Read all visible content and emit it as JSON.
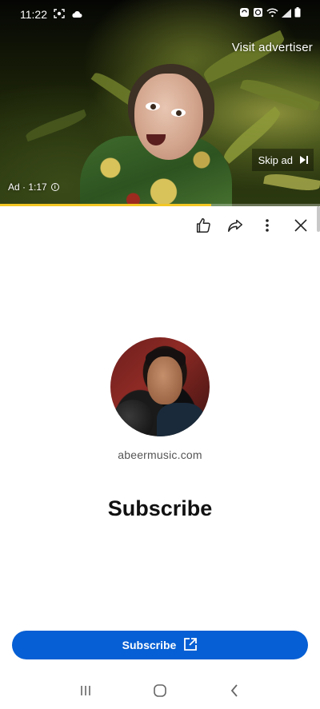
{
  "status_bar": {
    "time": "11:22",
    "icons": [
      "screenshot-icon",
      "cloud-icon",
      "sync-icon",
      "alarm-icon",
      "wifi-icon",
      "signal-icon",
      "battery-icon"
    ]
  },
  "ad": {
    "visit_advertiser": "Visit advertiser",
    "skip_label": "Skip ad",
    "timer": "Ad · 1:17",
    "progress": 0.66,
    "progress_color": "#f3c623"
  },
  "actions": {
    "icons": [
      "thumbs-up-icon",
      "share-icon",
      "more-vert-icon",
      "close-icon"
    ]
  },
  "advertiser": {
    "domain": "abeermusic.com",
    "headline": "Subscribe",
    "cta_label": "Subscribe",
    "cta_color": "#065fd4"
  },
  "nav": {
    "icons": [
      "recents-icon",
      "home-icon",
      "back-icon"
    ]
  }
}
